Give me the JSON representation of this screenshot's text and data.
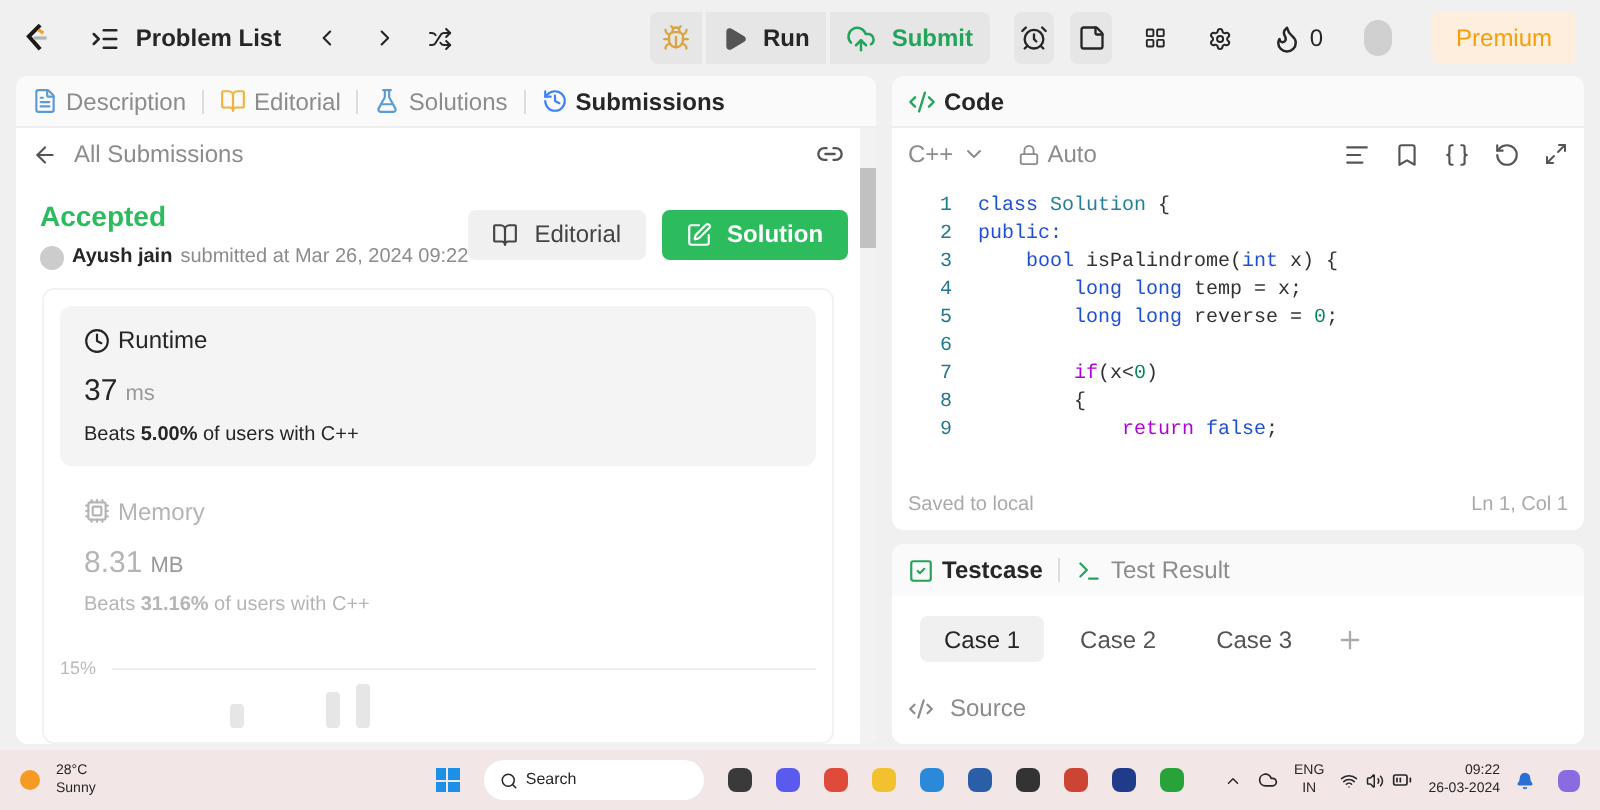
{
  "top_bar": {
    "problem_list": "Problem List",
    "run": "Run",
    "submit": "Submit",
    "streak": "0",
    "premium": "Premium"
  },
  "left_tabs": [
    {
      "label": "Description",
      "selected": false,
      "kind": "doc"
    },
    {
      "label": "Editorial",
      "selected": false,
      "kind": "book"
    },
    {
      "label": "Solutions",
      "selected": false,
      "kind": "flask"
    },
    {
      "label": "Submissions",
      "selected": true,
      "kind": "history"
    }
  ],
  "back_link": "All Submissions",
  "submission": {
    "status": "Accepted",
    "user": "Ayush jain",
    "submitted": "submitted at Mar 26, 2024 09:22",
    "editorial_button": "Editorial",
    "solution_button": "Solution"
  },
  "metrics": [
    {
      "title": "Runtime",
      "value": "37",
      "unit": "ms",
      "beats": "Beats **5.00%** of users with C++",
      "selected": true,
      "kind": "clock"
    },
    {
      "title": "Memory",
      "value": "8.31",
      "unit": "MB",
      "beats": "Beats **31.16%** of users with C++",
      "selected": false,
      "kind": "chip"
    }
  ],
  "chart_tick": "15%",
  "code_panel": {
    "title": "Code",
    "language": "C++",
    "mode": "Auto",
    "footer_left": "Saved to local",
    "footer_right": "Ln 1, Col 1"
  },
  "code_lines": [
    {
      "n": "1",
      "tokens": [
        {
          "t": "class ",
          "kind": "keyword"
        },
        {
          "t": "Solution",
          "kind": "type"
        },
        {
          "t": " {",
          "kind": "plain"
        }
      ]
    },
    {
      "n": "2",
      "tokens": [
        {
          "t": "public:",
          "kind": "keyword"
        }
      ]
    },
    {
      "n": "3",
      "tokens": [
        {
          "t": "    bool ",
          "kind": "keyword"
        },
        {
          "t": "isPalindrome(",
          "kind": "plain"
        },
        {
          "t": "int ",
          "kind": "keyword"
        },
        {
          "t": "x) {",
          "kind": "plain"
        }
      ]
    },
    {
      "n": "4",
      "tokens": [
        {
          "t": "        long long ",
          "kind": "keyword"
        },
        {
          "t": "temp = x;",
          "kind": "plain"
        }
      ]
    },
    {
      "n": "5",
      "tokens": [
        {
          "t": "        long long ",
          "kind": "keyword"
        },
        {
          "t": "reverse = ",
          "kind": "plain"
        },
        {
          "t": "0",
          "kind": "number"
        },
        {
          "t": ";",
          "kind": "plain"
        }
      ]
    },
    {
      "n": "6"
    },
    {
      "n": "7",
      "tokens": [
        {
          "t": "        if",
          "kind": "control"
        },
        {
          "t": "(x<",
          "kind": "plain"
        },
        {
          "t": "0",
          "kind": "number"
        },
        {
          "t": ")",
          "kind": "plain"
        }
      ]
    },
    {
      "n": "8",
      "tokens": [
        {
          "t": "        {",
          "kind": "plain"
        }
      ]
    },
    {
      "n": "9",
      "tokens": [
        {
          "t": "            return ",
          "kind": "control"
        },
        {
          "t": "false",
          "kind": "keyword"
        },
        {
          "t": ";",
          "kind": "plain"
        }
      ]
    }
  ],
  "test_tabs": [
    {
      "label": "Testcase",
      "selected": true,
      "kind": "check"
    },
    {
      "label": "Test Result",
      "selected": false,
      "kind": "terminal"
    }
  ],
  "cases": [
    {
      "label": "Case 1",
      "selected": true
    },
    {
      "label": "Case 2",
      "selected": false
    },
    {
      "label": "Case 3",
      "selected": false
    }
  ],
  "source_label": "Source",
  "taskbar": {
    "temperature": "28°C",
    "weather": "Sunny",
    "search": "Search",
    "language": "ENG",
    "region": "IN",
    "time": "09:22",
    "date": "26-03-2024"
  }
}
